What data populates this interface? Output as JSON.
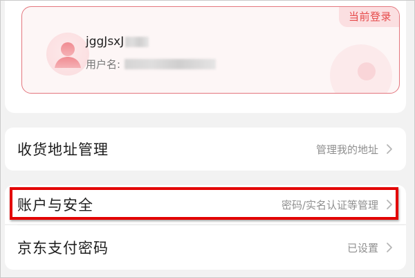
{
  "account_card": {
    "badge": "当前登录",
    "nickname": "jggJsxJ",
    "username_label": "用户名:"
  },
  "menu": {
    "address": {
      "title": "收货地址管理",
      "detail": "管理我的地址"
    },
    "security": {
      "title": "账户与安全",
      "detail": "密码/实名认证等管理"
    },
    "payment": {
      "title": "京东支付密码",
      "detail": "已设置"
    }
  },
  "colors": {
    "accent_red": "#e64a4a",
    "card_border": "#e3757d",
    "highlight": "#e30000"
  },
  "icons": {
    "avatar": "user-avatar-icon",
    "chevron": "chevron-right-icon"
  }
}
